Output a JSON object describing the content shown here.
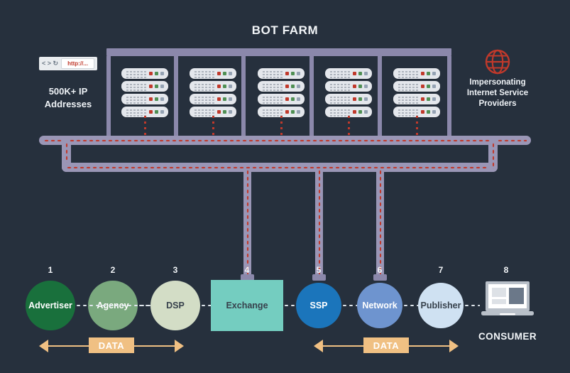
{
  "title": "BOT FARM",
  "browser": {
    "nav_glyphs": "< > ↻",
    "url_text": "http://...",
    "caption_line1": "500K+  IP",
    "caption_line2": "Addresses"
  },
  "isp": {
    "icon": "globe-icon",
    "line1": "Impersonating",
    "line2": "Internet Service",
    "line3": "Providers",
    "color": "#c0392b"
  },
  "bot_farm": {
    "rack_count": 5,
    "servers_per_rack": 4,
    "led_colors": [
      "#c0392b",
      "#4f8f53",
      "#94a2b3"
    ],
    "frame_color": "#8b88ab"
  },
  "bus": {
    "bar_color": "#9a96b6",
    "dot_color": "#c0392b"
  },
  "nodes": [
    {
      "num": "1",
      "label": "Advertiser",
      "shape": "circle",
      "fill": "#19703c",
      "text_color": "#ffffff"
    },
    {
      "num": "2",
      "label": "Agency",
      "shape": "circle",
      "fill": "#7aa97e",
      "text_color": "#ffffff"
    },
    {
      "num": "3",
      "label": "DSP",
      "shape": "circle",
      "fill": "#d3ddc6",
      "text_color": "#37414c"
    },
    {
      "num": "4",
      "label": "Exchange",
      "shape": "rect",
      "fill": "#74cdc0",
      "text_color": "#37414c"
    },
    {
      "num": "5",
      "label": "SSP",
      "shape": "circle",
      "fill": "#1b75bb",
      "text_color": "#ffffff"
    },
    {
      "num": "6",
      "label": "Network",
      "shape": "circle",
      "fill": "#6e94cf",
      "text_color": "#ffffff"
    },
    {
      "num": "7",
      "label": "Publisher",
      "shape": "circle",
      "fill": "#cfe1f2",
      "text_color": "#37414c"
    },
    {
      "num": "8",
      "label": "",
      "shape": "icon",
      "fill": "",
      "text_color": ""
    }
  ],
  "consumer": {
    "icon": "laptop-icon",
    "label": "CONSUMER"
  },
  "data_arrows": [
    {
      "label": "DATA"
    },
    {
      "label": "DATA"
    }
  ],
  "colors": {
    "background": "#26303d",
    "accent_data": "#f0c083",
    "text": "#f2f5f8"
  }
}
